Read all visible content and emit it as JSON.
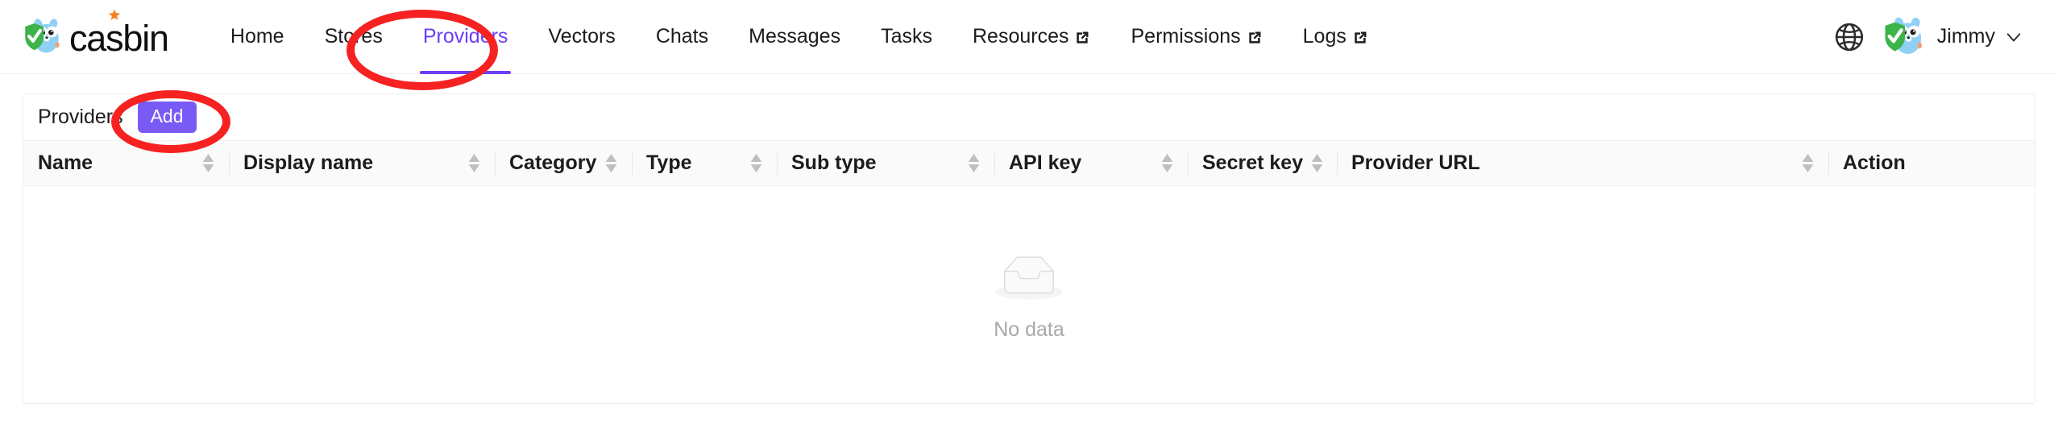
{
  "brand": {
    "name": "casbin",
    "logo_icon": "casbin-gopher-shield-logo",
    "star_icon": "star-icon"
  },
  "nav": {
    "items": [
      {
        "label": "Home",
        "active": false,
        "external": false,
        "icon": ""
      },
      {
        "label": "Stores",
        "active": false,
        "external": false,
        "icon": ""
      },
      {
        "label": "Providers",
        "active": true,
        "external": false,
        "icon": ""
      },
      {
        "label": "Vectors",
        "active": false,
        "external": false,
        "icon": ""
      },
      {
        "label": "Chats",
        "active": false,
        "external": false,
        "icon": ""
      },
      {
        "label": "Messages",
        "active": false,
        "external": false,
        "icon": ""
      },
      {
        "label": "Tasks",
        "active": false,
        "external": false,
        "icon": ""
      },
      {
        "label": "Resources",
        "active": false,
        "external": true,
        "icon": "external-link-icon"
      },
      {
        "label": "Permissions",
        "active": false,
        "external": true,
        "icon": "external-link-icon"
      },
      {
        "label": "Logs",
        "active": false,
        "external": true,
        "icon": "external-link-icon"
      }
    ]
  },
  "topbar_right": {
    "language_icon": "globe-icon",
    "avatar_icon": "casbin-gopher-shield-avatar",
    "user_name": "Jimmy",
    "dropdown_icon": "chevron-down-icon"
  },
  "card": {
    "title": "Providers",
    "add_label": "Add"
  },
  "table": {
    "columns": [
      {
        "label": "Name",
        "sortable": true
      },
      {
        "label": "Display name",
        "sortable": true
      },
      {
        "label": "Category",
        "sortable": true
      },
      {
        "label": "Type",
        "sortable": true
      },
      {
        "label": "Sub type",
        "sortable": true
      },
      {
        "label": "API key",
        "sortable": true
      },
      {
        "label": "Secret key",
        "sortable": true
      },
      {
        "label": "Provider URL",
        "sortable": true
      },
      {
        "label": "Action",
        "sortable": false
      }
    ],
    "rows": [],
    "empty": {
      "text": "No data",
      "icon": "empty-box-icon"
    }
  },
  "annotations": [
    {
      "name": "highlight-providers-tab",
      "shape": "ellipse",
      "color": "#f62222"
    },
    {
      "name": "highlight-add-button",
      "shape": "ellipse",
      "color": "#f62222"
    }
  ],
  "colors": {
    "accent_purple": "#6c3ef4",
    "button_purple": "#7a5af5",
    "annotation_red": "#f62222",
    "header_bg": "#fafafa",
    "border": "#f0f0f0"
  }
}
